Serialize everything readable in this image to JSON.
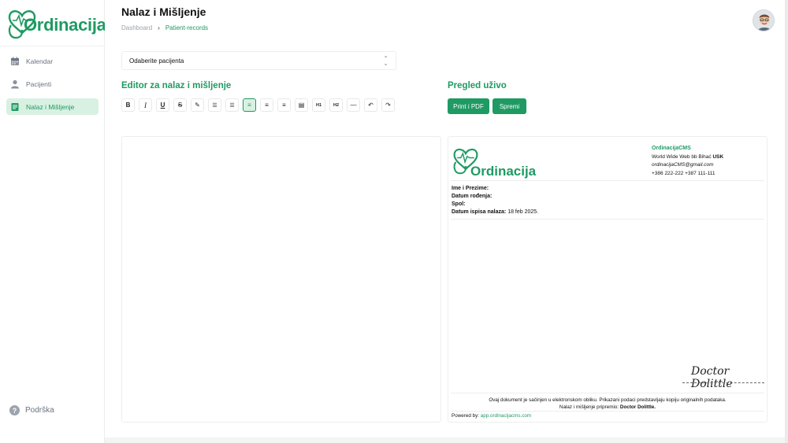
{
  "app": {
    "brand": "Ordinacija",
    "brand_color": "#1f9a63"
  },
  "sidebar": {
    "items": [
      {
        "label": "Kalendar",
        "icon": "calendar-icon",
        "active": false
      },
      {
        "label": "Pacijenti",
        "icon": "user-icon",
        "active": false
      },
      {
        "label": "Nalaz i Mišljenje",
        "icon": "document-icon",
        "active": true
      }
    ],
    "support_label": "Podrška"
  },
  "header": {
    "title": "Nalaz i Mišljenje",
    "breadcrumb": [
      "Dashboard",
      "Patient-records"
    ]
  },
  "patient_select": {
    "value": "Odaberite pacijenta"
  },
  "editor": {
    "heading": "Editor za nalaz i mišljenje",
    "toolbar": [
      {
        "name": "bold",
        "glyph": "B"
      },
      {
        "name": "italic",
        "glyph": "I"
      },
      {
        "name": "underline",
        "glyph": "U"
      },
      {
        "name": "strikethrough",
        "glyph": "S"
      },
      {
        "name": "highlight",
        "glyph": "✎"
      },
      {
        "name": "bullet-list",
        "glyph": "☰"
      },
      {
        "name": "ordered-list",
        "glyph": "☰"
      },
      {
        "name": "align-left",
        "glyph": "≡",
        "active": true
      },
      {
        "name": "align-center",
        "glyph": "≡"
      },
      {
        "name": "align-right",
        "glyph": "≡"
      },
      {
        "name": "align-justify",
        "glyph": "▤"
      },
      {
        "name": "heading-1",
        "glyph": "H1"
      },
      {
        "name": "heading-2",
        "glyph": "H2"
      },
      {
        "name": "horizontal-rule",
        "glyph": "—"
      },
      {
        "name": "undo",
        "glyph": "↶"
      },
      {
        "name": "redo",
        "glyph": "↷"
      }
    ]
  },
  "preview": {
    "heading": "Pregled uživo",
    "print_button": "Print i PDF",
    "save_button": "Spremi",
    "company": {
      "name": "OrdinacijaCMS",
      "address": "World Wide Web bb Bihać",
      "country": "USK",
      "email": "ordinacijaCMS@gmail.com",
      "phone": "+386 222-222 +387 111-111"
    },
    "fields": {
      "name_label": "Ime i Prezime:",
      "dob_label": "Datum rođenja:",
      "sex_label": "Spol:",
      "print_date_label": "Datum ispisa nalaza:",
      "print_date_value": "18 feb 2025."
    },
    "signature": "Doctor Dolittle",
    "footer_line1": "Ovaj dokument je sačinjen u elektronskom obliku. Prikazani podaci predstavljaju kopiju originalnih podataka.",
    "footer_line2_prefix": "Nalaz i mišljenje pripremio:",
    "footer_line2_name": "Doctor Dolittle.",
    "powered_label": "Powered by:",
    "powered_link": "app.ordinacijacms.com"
  }
}
